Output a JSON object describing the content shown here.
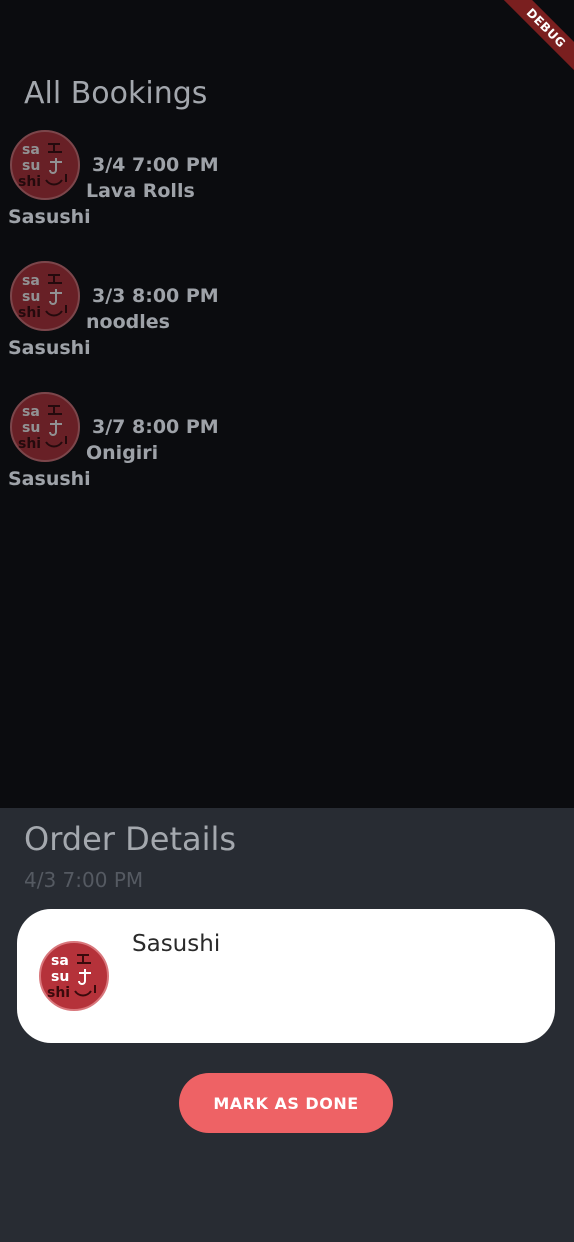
{
  "debug_banner": "DEBUG",
  "page_title": "All Bookings",
  "bookings": [
    {
      "datetime": "3/4 7:00 PM",
      "item": "Lava Rolls",
      "restaurant": "Sasushi"
    },
    {
      "datetime": "3/3 8:00 PM",
      "item": "noodles",
      "restaurant": "Sasushi"
    },
    {
      "datetime": "3/7 8:00 PM",
      "item": "Onigiri",
      "restaurant": "Sasushi"
    }
  ],
  "logo_text": [
    "sa",
    "su",
    "shi"
  ],
  "order_details": {
    "title": "Order Details",
    "datetime": "4/3 7:00 PM",
    "restaurant": "Sasushi",
    "button_label": "MARK AS DONE"
  },
  "colors": {
    "background": "#0b0c0f",
    "sheet": "#282c33",
    "accent": "#ee6265",
    "logo_red": "#b5323a"
  }
}
